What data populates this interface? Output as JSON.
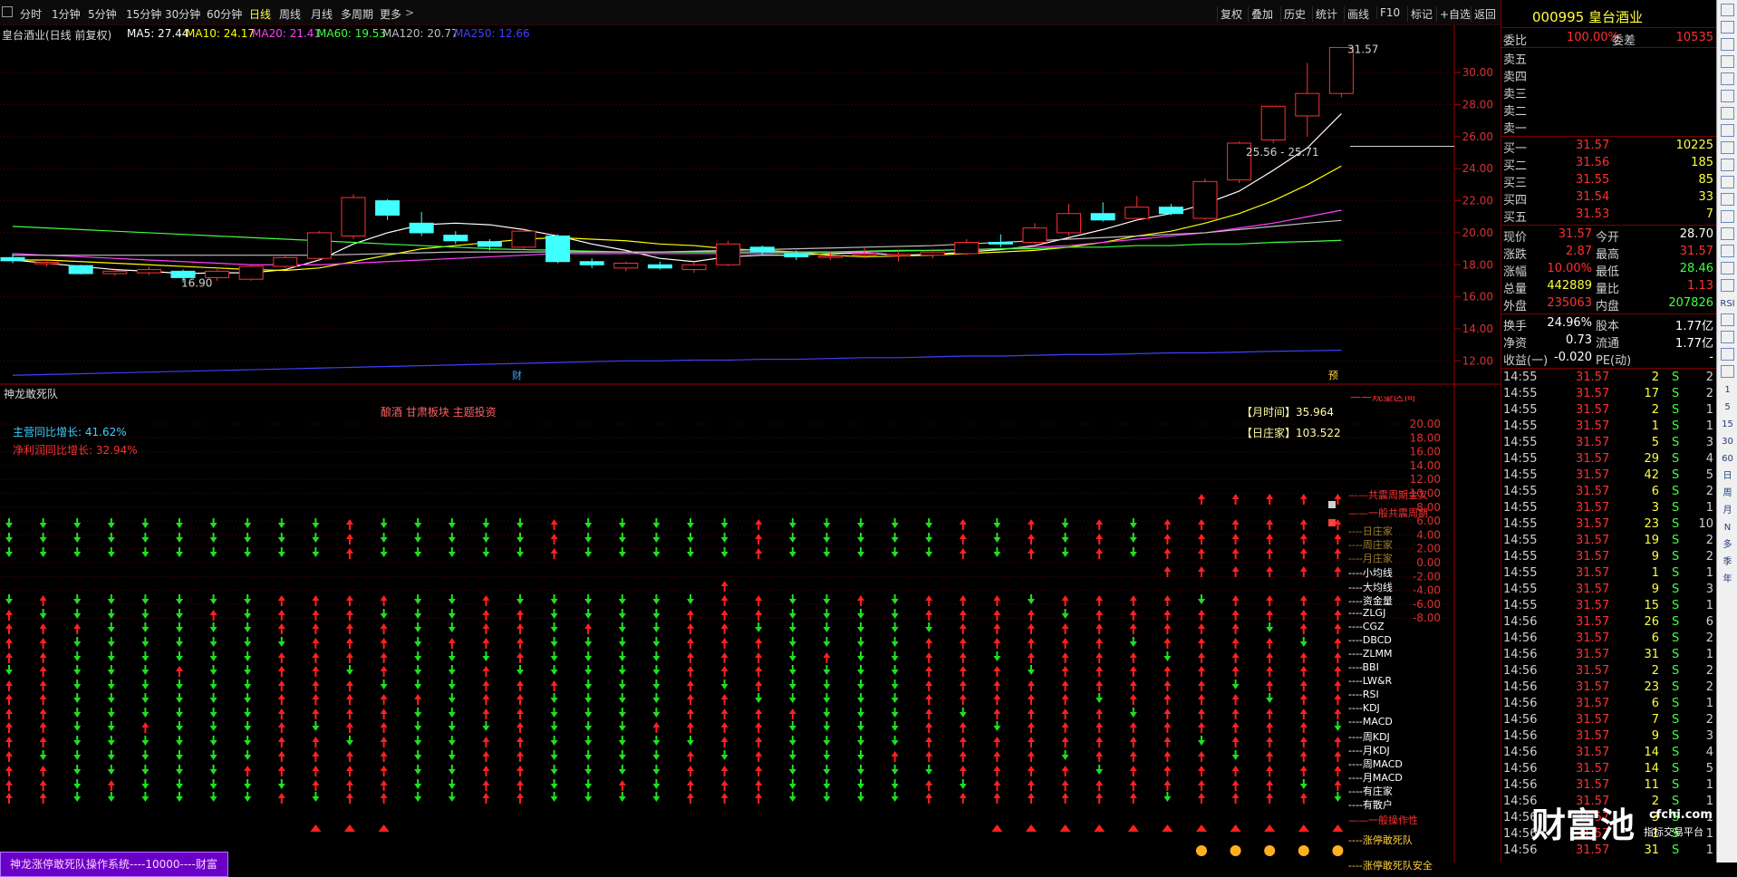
{
  "toolbar": {
    "periods": [
      "分时",
      "1分钟",
      "5分钟",
      "15分钟",
      "30分钟",
      "60分钟",
      "日线",
      "周线",
      "月线",
      "多周期",
      "更多"
    ],
    "active_period": "日线",
    "tools": [
      "复权",
      "叠加",
      "历史",
      "统计",
      "画线",
      "F10",
      "标记",
      "+自选",
      "返回"
    ]
  },
  "header": {
    "stock_title": "皇台酒业(日线 前复权)",
    "ma": [
      {
        "label": "MA5: 27.44",
        "color": "#ffffff"
      },
      {
        "label": "MA10: 24.17",
        "color": "#ffff00"
      },
      {
        "label": "MA20: 21.41",
        "color": "#ff40ff"
      },
      {
        "label": "MA60: 19.53",
        "color": "#40ff40"
      },
      {
        "label": "MA120: 20.77",
        "color": "#c0c0c0"
      },
      {
        "label": "MA250: 12.66",
        "color": "#4040ff"
      }
    ]
  },
  "price_axis": [
    "30.00",
    "28.00",
    "26.00",
    "24.00",
    "22.00",
    "20.00",
    "18.00",
    "16.00",
    "14.00",
    "12.00"
  ],
  "annotations": {
    "high": "31.57",
    "low": "16.90",
    "range": "25.56 - 25.71",
    "cai": "财",
    "ji": "预"
  },
  "indicator": {
    "title": "神龙敢死队",
    "theme": "酿酒 甘肃板块 主题投资",
    "growth_revenue": "主营同比增长: 41.62%",
    "growth_profit": "净利润同比增长: 32.94%",
    "month_time": "【月时间】35.964",
    "day_dealer": "【日庄家】103.522",
    "axis": [
      "20.00",
      "18.00",
      "16.00",
      "14.00",
      "12.00",
      "10.00",
      "8.00",
      "6.00",
      "4.00",
      "2.00",
      "0.00",
      "-2.00",
      "-4.00",
      "-6.00",
      "-8.00"
    ],
    "right_labels": [
      {
        "text": "——共震周期金叉",
        "color": "#ff3030"
      },
      {
        "text": "——一般共震周期",
        "color": "#ff3030"
      },
      {
        "text": "----日庄家",
        "color": "#a08030"
      },
      {
        "text": "----周庄家",
        "color": "#a08030"
      },
      {
        "text": "----月庄家",
        "color": "#a08030"
      },
      {
        "text": "----小均线",
        "color": "#ffffff"
      },
      {
        "text": "----大均线",
        "color": "#ffffff"
      },
      {
        "text": "----资金量",
        "color": "#ffffff"
      },
      {
        "text": "----ZLGJ",
        "color": "#ffffff"
      },
      {
        "text": "----CGZ",
        "color": "#ffffff"
      },
      {
        "text": "----DBCD",
        "color": "#ffffff"
      },
      {
        "text": "----ZLMM",
        "color": "#ffffff"
      },
      {
        "text": "----BBI",
        "color": "#ffffff"
      },
      {
        "text": "----LW&R",
        "color": "#ffffff"
      },
      {
        "text": "----RSI",
        "color": "#ffffff"
      },
      {
        "text": "----KDJ",
        "color": "#ffffff"
      },
      {
        "text": "----MACD",
        "color": "#ffffff"
      },
      {
        "text": "----周KDJ",
        "color": "#ffffff"
      },
      {
        "text": "----月KDJ",
        "color": "#ffffff"
      },
      {
        "text": "----周MACD",
        "color": "#ffffff"
      },
      {
        "text": "----月MACD",
        "color": "#ffffff"
      },
      {
        "text": "----有庄家",
        "color": "#ffffff"
      },
      {
        "text": "----有散户",
        "color": "#ffffff"
      },
      {
        "text": "——一般操作性",
        "color": "#ff3030"
      },
      {
        "text": "----涨停敢死队",
        "color": "#ffd040"
      },
      {
        "text": "----涨停敢死队安全",
        "color": "#ffd040"
      }
    ],
    "top_cut_label": "——观望区间",
    "footer": "神龙涨停敢死队操作系统----10000----财富"
  },
  "quote": {
    "code_name": "000995 皇台酒业",
    "weibi": {
      "l": "委比",
      "v": "100.00%",
      "l2": "委差",
      "v2": "10535"
    },
    "sells": [
      {
        "l": "卖五"
      },
      {
        "l": "卖四"
      },
      {
        "l": "卖三"
      },
      {
        "l": "卖二"
      },
      {
        "l": "卖一"
      }
    ],
    "buys": [
      {
        "l": "买一",
        "p": "31.57",
        "v": "10225"
      },
      {
        "l": "买二",
        "p": "31.56",
        "v": "185"
      },
      {
        "l": "买三",
        "p": "31.55",
        "v": "85"
      },
      {
        "l": "买四",
        "p": "31.54",
        "v": "33"
      },
      {
        "l": "买五",
        "p": "31.53",
        "v": "7"
      }
    ],
    "stats": [
      {
        "l": "现价",
        "v": "31.57",
        "c": "#ff3030",
        "l2": "今开",
        "v2": "28.70",
        "c2": "#ffffff"
      },
      {
        "l": "涨跌",
        "v": "2.87",
        "c": "#ff3030",
        "l2": "最高",
        "v2": "31.57",
        "c2": "#ff3030"
      },
      {
        "l": "涨幅",
        "v": "10.00%",
        "c": "#ff3030",
        "l2": "最低",
        "v2": "28.46",
        "c2": "#40ff40"
      },
      {
        "l": "总量",
        "v": "442889",
        "c": "#ffff40",
        "l2": "量比",
        "v2": "1.13",
        "c2": "#ff3030"
      },
      {
        "l": "外盘",
        "v": "235063",
        "c": "#ff3030",
        "l2": "内盘",
        "v2": "207826",
        "c2": "#40ff40"
      }
    ],
    "stats2": [
      {
        "l": "换手",
        "v": "24.96%",
        "l2": "股本",
        "v2": "1.77亿"
      },
      {
        "l": "净资",
        "v": "0.73",
        "l2": "流通",
        "v2": "1.77亿"
      },
      {
        "l": "收益(一)",
        "v": "-0.020",
        "l2": "PE(动)",
        "v2": "-"
      }
    ],
    "ticks": [
      {
        "t": "14:55",
        "p": "31.57",
        "v": "2",
        "d": "S",
        "n": "2"
      },
      {
        "t": "14:55",
        "p": "31.57",
        "v": "17",
        "d": "S",
        "n": "2"
      },
      {
        "t": "14:55",
        "p": "31.57",
        "v": "2",
        "d": "S",
        "n": "1"
      },
      {
        "t": "14:55",
        "p": "31.57",
        "v": "1",
        "d": "S",
        "n": "1"
      },
      {
        "t": "14:55",
        "p": "31.57",
        "v": "5",
        "d": "S",
        "n": "3"
      },
      {
        "t": "14:55",
        "p": "31.57",
        "v": "29",
        "d": "S",
        "n": "4"
      },
      {
        "t": "14:55",
        "p": "31.57",
        "v": "42",
        "d": "S",
        "n": "5"
      },
      {
        "t": "14:55",
        "p": "31.57",
        "v": "6",
        "d": "S",
        "n": "2"
      },
      {
        "t": "14:55",
        "p": "31.57",
        "v": "3",
        "d": "S",
        "n": "1"
      },
      {
        "t": "14:55",
        "p": "31.57",
        "v": "23",
        "d": "S",
        "n": "10"
      },
      {
        "t": "14:55",
        "p": "31.57",
        "v": "19",
        "d": "S",
        "n": "2"
      },
      {
        "t": "14:55",
        "p": "31.57",
        "v": "9",
        "d": "S",
        "n": "2"
      },
      {
        "t": "14:55",
        "p": "31.57",
        "v": "1",
        "d": "S",
        "n": "1"
      },
      {
        "t": "14:55",
        "p": "31.57",
        "v": "9",
        "d": "S",
        "n": "3"
      },
      {
        "t": "14:55",
        "p": "31.57",
        "v": "15",
        "d": "S",
        "n": "1"
      },
      {
        "t": "14:56",
        "p": "31.57",
        "v": "26",
        "d": "S",
        "n": "6"
      },
      {
        "t": "14:56",
        "p": "31.57",
        "v": "6",
        "d": "S",
        "n": "2"
      },
      {
        "t": "14:56",
        "p": "31.57",
        "v": "31",
        "d": "S",
        "n": "1"
      },
      {
        "t": "14:56",
        "p": "31.57",
        "v": "2",
        "d": "S",
        "n": "2"
      },
      {
        "t": "14:56",
        "p": "31.57",
        "v": "23",
        "d": "S",
        "n": "2"
      },
      {
        "t": "14:56",
        "p": "31.57",
        "v": "6",
        "d": "S",
        "n": "1"
      },
      {
        "t": "14:56",
        "p": "31.57",
        "v": "7",
        "d": "S",
        "n": "2"
      },
      {
        "t": "14:56",
        "p": "31.57",
        "v": "9",
        "d": "S",
        "n": "3"
      },
      {
        "t": "14:56",
        "p": "31.57",
        "v": "14",
        "d": "S",
        "n": "4"
      },
      {
        "t": "14:56",
        "p": "31.57",
        "v": "14",
        "d": "S",
        "n": "5"
      },
      {
        "t": "14:56",
        "p": "31.57",
        "v": "11",
        "d": "S",
        "n": "1"
      },
      {
        "t": "14:56",
        "p": "31.57",
        "v": "2",
        "d": "S",
        "n": "1"
      },
      {
        "t": "14:56",
        "p": "31.57",
        "v": "3",
        "d": "S",
        "n": "1"
      },
      {
        "t": "14:56",
        "p": "31.57",
        "v": "1",
        "d": "S",
        "n": "1"
      },
      {
        "t": "14:56",
        "p": "31.57",
        "v": "31",
        "d": "S",
        "n": "1"
      }
    ]
  },
  "right_tools": [
    "",
    "",
    "",
    "",
    "",
    "",
    "",
    "",
    "",
    "",
    "",
    "",
    "",
    "",
    "",
    "",
    "",
    "RSI",
    "",
    "",
    "",
    "",
    "1",
    "5",
    "15",
    "30",
    "60",
    "日",
    "周",
    "月",
    "N",
    "多",
    "季",
    "年"
  ],
  "watermark": {
    "big": "财富池",
    "url": "cfchi.com",
    "sub": "指标交易平台"
  },
  "chart_data": {
    "type": "candlestick",
    "ylim": [
      11,
      32.5
    ],
    "candles": [
      {
        "o": 18.45,
        "c": 18.25,
        "h": 18.7,
        "l": 18.1
      },
      {
        "o": 18.1,
        "c": 18.15,
        "h": 18.3,
        "l": 17.9
      },
      {
        "o": 17.95,
        "c": 17.45,
        "h": 18.0,
        "l": 17.4
      },
      {
        "o": 17.45,
        "c": 17.6,
        "h": 17.8,
        "l": 17.3
      },
      {
        "o": 17.5,
        "c": 17.7,
        "h": 17.9,
        "l": 17.35
      },
      {
        "o": 17.6,
        "c": 17.2,
        "h": 17.7,
        "l": 16.9
      },
      {
        "o": 17.2,
        "c": 17.6,
        "h": 17.7,
        "l": 17.0
      },
      {
        "o": 17.1,
        "c": 17.9,
        "h": 18.0,
        "l": 17.0
      },
      {
        "o": 17.9,
        "c": 18.45,
        "h": 18.6,
        "l": 17.8
      },
      {
        "o": 18.4,
        "c": 20.0,
        "h": 20.1,
        "l": 18.3
      },
      {
        "o": 19.8,
        "c": 22.2,
        "h": 22.4,
        "l": 19.6
      },
      {
        "o": 22.0,
        "c": 21.1,
        "h": 22.1,
        "l": 20.8
      },
      {
        "o": 20.6,
        "c": 20.0,
        "h": 21.3,
        "l": 19.8
      },
      {
        "o": 19.85,
        "c": 19.5,
        "h": 20.1,
        "l": 19.3
      },
      {
        "o": 19.45,
        "c": 19.15,
        "h": 19.6,
        "l": 18.9
      },
      {
        "o": 19.1,
        "c": 20.1,
        "h": 20.3,
        "l": 19.0
      },
      {
        "o": 19.8,
        "c": 18.2,
        "h": 19.9,
        "l": 18.1
      },
      {
        "o": 18.2,
        "c": 18.0,
        "h": 18.4,
        "l": 17.8
      },
      {
        "o": 17.8,
        "c": 18.1,
        "h": 18.2,
        "l": 17.6
      },
      {
        "o": 18.0,
        "c": 17.8,
        "h": 18.2,
        "l": 17.7
      },
      {
        "o": 17.7,
        "c": 18.0,
        "h": 18.2,
        "l": 17.5
      },
      {
        "o": 18.0,
        "c": 19.3,
        "h": 19.5,
        "l": 17.9
      },
      {
        "o": 19.1,
        "c": 18.8,
        "h": 19.2,
        "l": 18.6
      },
      {
        "o": 18.7,
        "c": 18.5,
        "h": 18.9,
        "l": 18.3
      },
      {
        "o": 18.5,
        "c": 18.55,
        "h": 18.8,
        "l": 18.3
      },
      {
        "o": 18.6,
        "c": 18.7,
        "h": 19.1,
        "l": 18.4
      },
      {
        "o": 18.6,
        "c": 18.65,
        "h": 18.9,
        "l": 18.2
      },
      {
        "o": 18.6,
        "c": 18.8,
        "h": 19.0,
        "l": 18.4
      },
      {
        "o": 18.7,
        "c": 19.4,
        "h": 19.6,
        "l": 18.6
      },
      {
        "o": 19.4,
        "c": 19.3,
        "h": 19.9,
        "l": 19.1
      },
      {
        "o": 19.4,
        "c": 20.3,
        "h": 20.6,
        "l": 19.3
      },
      {
        "o": 20.0,
        "c": 21.2,
        "h": 21.8,
        "l": 19.8
      },
      {
        "o": 21.2,
        "c": 20.8,
        "h": 21.9,
        "l": 20.7
      },
      {
        "o": 20.9,
        "c": 21.6,
        "h": 22.3,
        "l": 20.8
      },
      {
        "o": 21.6,
        "c": 21.2,
        "h": 21.8,
        "l": 21.1
      },
      {
        "o": 20.9,
        "c": 23.2,
        "h": 23.4,
        "l": 20.8
      },
      {
        "o": 23.3,
        "c": 25.6,
        "h": 25.7,
        "l": 23.1
      },
      {
        "o": 25.8,
        "c": 27.9,
        "h": 27.9,
        "l": 25.6
      },
      {
        "o": 27.3,
        "c": 28.7,
        "h": 30.6,
        "l": 26.0
      },
      {
        "o": 28.7,
        "c": 31.57,
        "h": 31.57,
        "l": 28.46
      }
    ],
    "ma_lines": [
      {
        "name": "MA5",
        "color": "#ffffff",
        "values": [
          18.3,
          18.1,
          17.9,
          17.7,
          17.6,
          17.45,
          17.5,
          17.5,
          17.7,
          18.3,
          19.3,
          20.0,
          20.5,
          20.6,
          20.5,
          20.2,
          19.8,
          19.3,
          18.9,
          18.4,
          18.2,
          18.5,
          18.6,
          18.6,
          18.7,
          18.75,
          18.6,
          18.65,
          18.8,
          18.95,
          19.2,
          19.7,
          20.2,
          20.8,
          21.2,
          21.8,
          22.6,
          23.9,
          25.3,
          27.44
        ]
      },
      {
        "name": "MA10",
        "color": "#ffff00",
        "values": [
          18.3,
          18.3,
          18.2,
          18.1,
          18.0,
          17.9,
          17.8,
          17.7,
          17.65,
          17.8,
          18.2,
          18.6,
          19.0,
          19.2,
          19.4,
          19.6,
          19.7,
          19.6,
          19.5,
          19.3,
          19.2,
          19.0,
          18.9,
          18.8,
          18.6,
          18.5,
          18.55,
          18.6,
          18.7,
          18.8,
          18.9,
          19.1,
          19.4,
          19.8,
          20.1,
          20.6,
          21.2,
          22.0,
          23.0,
          24.17
        ]
      },
      {
        "name": "MA20",
        "color": "#ff40ff",
        "values": [
          18.7,
          18.6,
          18.5,
          18.4,
          18.3,
          18.2,
          18.1,
          18.0,
          18.0,
          18.0,
          18.1,
          18.2,
          18.3,
          18.4,
          18.5,
          18.6,
          18.7,
          18.7,
          18.7,
          18.7,
          18.7,
          18.7,
          18.7,
          18.75,
          18.8,
          18.8,
          18.85,
          18.9,
          18.95,
          19.0,
          19.1,
          19.2,
          19.4,
          19.6,
          19.8,
          20.0,
          20.3,
          20.6,
          21.0,
          21.41
        ]
      },
      {
        "name": "MA60",
        "color": "#40ff40",
        "values": [
          20.4,
          20.3,
          20.2,
          20.1,
          20.0,
          19.9,
          19.8,
          19.7,
          19.6,
          19.5,
          19.4,
          19.3,
          19.2,
          19.1,
          19.0,
          18.95,
          18.9,
          18.85,
          18.8,
          18.8,
          18.8,
          18.8,
          18.8,
          18.8,
          18.8,
          18.85,
          18.9,
          18.9,
          18.95,
          19.0,
          19.0,
          19.1,
          19.1,
          19.2,
          19.2,
          19.3,
          19.3,
          19.4,
          19.45,
          19.53
        ]
      },
      {
        "name": "MA120",
        "color": "#c0c0c0",
        "values": [
          18.6,
          18.6,
          18.6,
          18.6,
          18.6,
          18.6,
          18.6,
          18.6,
          18.6,
          18.6,
          18.65,
          18.7,
          18.75,
          18.8,
          18.8,
          18.8,
          18.8,
          18.8,
          18.8,
          18.8,
          18.85,
          18.9,
          18.95,
          19.0,
          19.05,
          19.1,
          19.15,
          19.2,
          19.3,
          19.4,
          19.5,
          19.6,
          19.7,
          19.8,
          19.9,
          20.0,
          20.2,
          20.4,
          20.6,
          20.77
        ]
      },
      {
        "name": "MA250",
        "color": "#4040ff",
        "values": [
          11.1,
          11.15,
          11.2,
          11.25,
          11.3,
          11.35,
          11.4,
          11.45,
          11.5,
          11.55,
          11.6,
          11.65,
          11.7,
          11.75,
          11.8,
          11.85,
          11.9,
          11.95,
          12.0,
          12.0,
          12.05,
          12.05,
          12.1,
          12.1,
          12.15,
          12.2,
          12.2,
          12.25,
          12.3,
          12.3,
          12.35,
          12.4,
          12.4,
          12.45,
          12.5,
          12.5,
          12.55,
          12.6,
          12.63,
          12.66
        ]
      }
    ]
  }
}
